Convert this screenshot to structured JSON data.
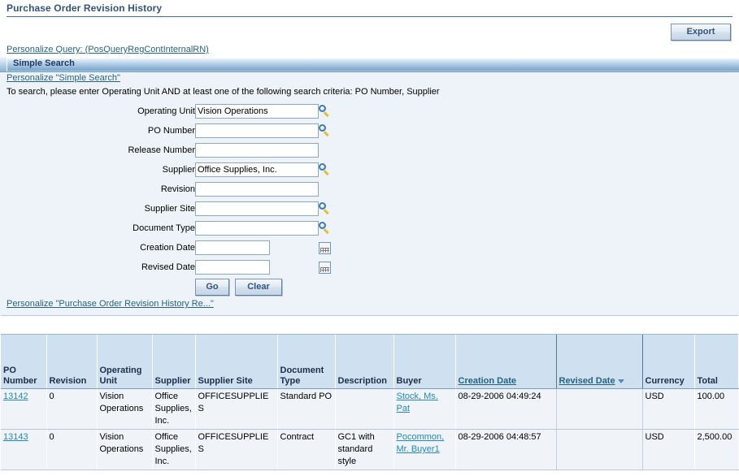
{
  "page": {
    "title": "Purchase Order Revision History"
  },
  "toolbar": {
    "export_label": "Export"
  },
  "links": {
    "personalize_query": "Personalize Query: (PosQueryRegContInternalRN)",
    "personalize_simple_search": "Personalize \"Simple Search\"",
    "personalize_results": "Personalize \"Purchase Order Revision History Re...\""
  },
  "search": {
    "region_title": "Simple Search",
    "hint": "To search, please enter Operating Unit AND at least one of the following search criteria: PO Number, Supplier",
    "fields": [
      {
        "label": "Operating Unit",
        "value": "Vision Operations",
        "type": "lov",
        "icon": "search-icon"
      },
      {
        "label": "PO Number",
        "value": "",
        "type": "lov",
        "icon": "search-icon"
      },
      {
        "label": "Release Number",
        "value": "",
        "type": "text",
        "icon": ""
      },
      {
        "label": "Supplier",
        "value": "Office Supplies, Inc.",
        "type": "lov",
        "icon": "search-icon"
      },
      {
        "label": "Revision",
        "value": "",
        "type": "text",
        "icon": ""
      },
      {
        "label": "Supplier Site",
        "value": "",
        "type": "lov",
        "icon": "search-icon"
      },
      {
        "label": "Document Type",
        "value": "",
        "type": "lov",
        "icon": "search-icon"
      },
      {
        "label": "Creation Date",
        "value": "",
        "type": "date",
        "icon": "calendar-icon"
      },
      {
        "label": "Revised Date",
        "value": "",
        "type": "date",
        "icon": "calendar-icon"
      }
    ],
    "go_label": "Go",
    "clear_label": "Clear"
  },
  "results": {
    "columns": [
      {
        "label": "PO Number",
        "sortable": false
      },
      {
        "label": "Revision",
        "sortable": false
      },
      {
        "label": "Operating Unit",
        "sortable": false
      },
      {
        "label": "Supplier",
        "sortable": false
      },
      {
        "label": "Supplier Site",
        "sortable": false
      },
      {
        "label": "Document Type",
        "sortable": false
      },
      {
        "label": "Description",
        "sortable": false
      },
      {
        "label": "Buyer",
        "sortable": false
      },
      {
        "label": "Creation Date",
        "sortable": true,
        "sort": "none"
      },
      {
        "label": "Revised Date",
        "sortable": true,
        "sort": "descending"
      },
      {
        "label": "Currency",
        "sortable": false
      },
      {
        "label": "Total",
        "sortable": false
      }
    ],
    "rows": [
      {
        "po_number": "13142",
        "revision": "0",
        "operating_unit": "Vision Operations",
        "supplier": "Office Supplies, Inc.",
        "supplier_site": "OFFICESUPPLIES",
        "document_type": "Standard PO",
        "description": "",
        "buyer": "Stock, Ms. Pat",
        "creation_date": "08-29-2006 04:49:24",
        "revised_date": "",
        "currency": "USD",
        "total": "100.00"
      },
      {
        "po_number": "13143",
        "revision": "0",
        "operating_unit": "Vision Operations",
        "supplier": "Office Supplies, Inc.",
        "supplier_site": "OFFICESUPPLIES",
        "document_type": "Contract",
        "description": "GC1 with standard style",
        "buyer": "Pocommon, Mr. Buyer1",
        "creation_date": "08-29-2006 04:48:57",
        "revised_date": "",
        "currency": "USD",
        "total": "2,500.00"
      }
    ]
  },
  "colors": {
    "title": "#33537a",
    "link": "#26647e",
    "data_link": "#2288b5",
    "panel_bg": "#eef3f9",
    "header_bg": "#cfe0f0",
    "row_bg": "#f0f4f8"
  }
}
